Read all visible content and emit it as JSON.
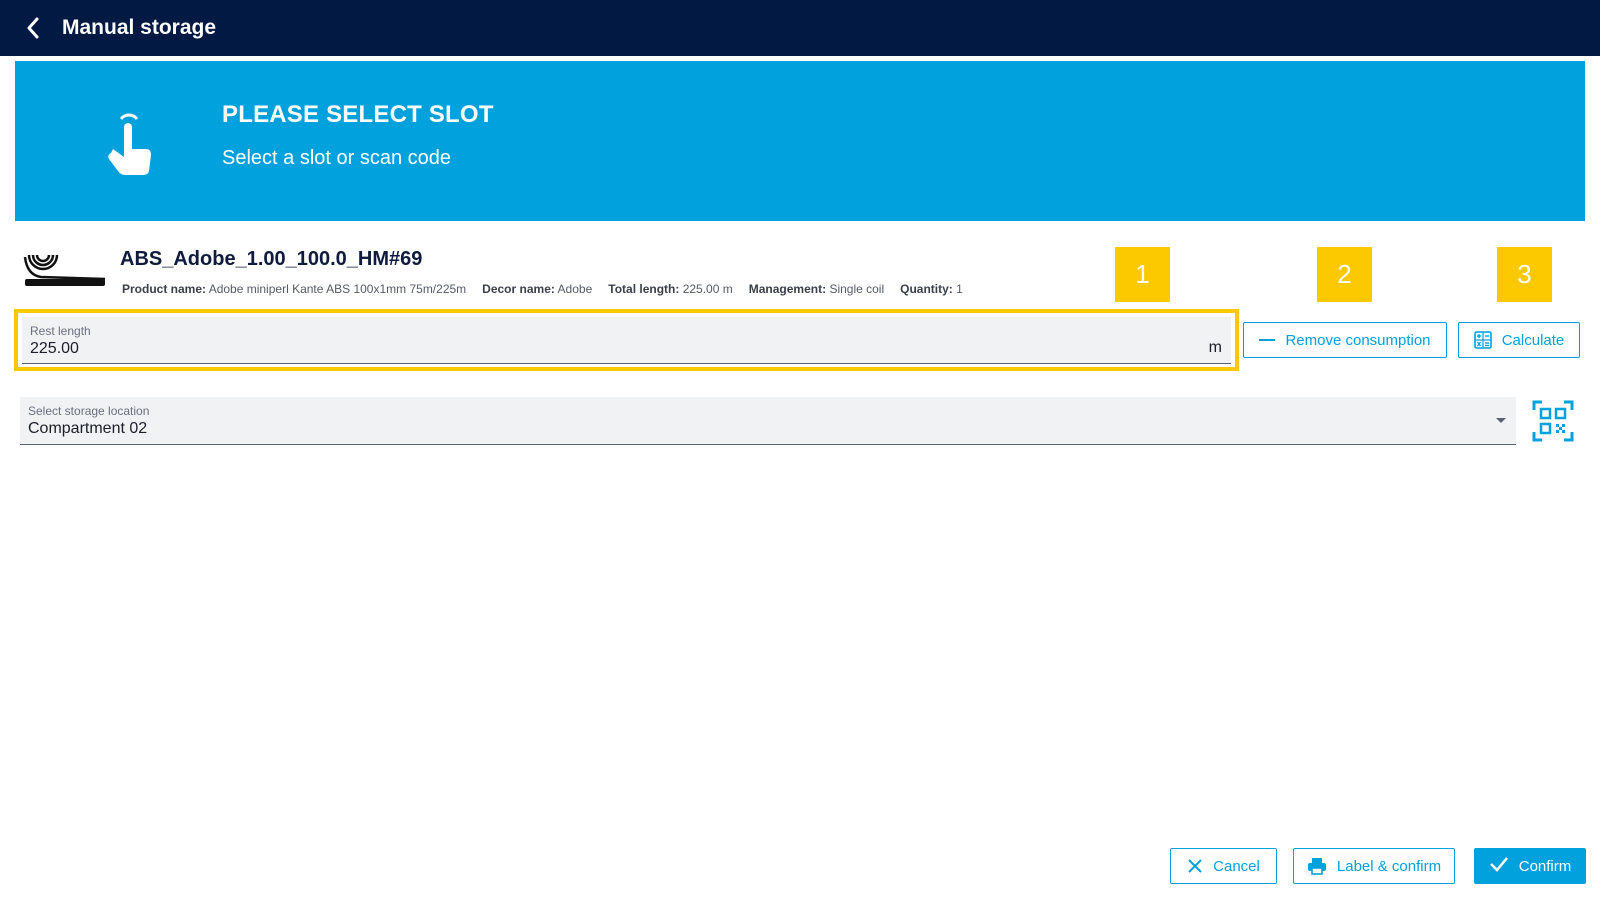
{
  "header": {
    "title": "Manual storage",
    "back_icon": "chevron-left-icon"
  },
  "banner": {
    "title": "PLEASE SELECT SLOT",
    "subtitle": "Select a slot or scan code",
    "icon": "touch-hand-icon",
    "color": "#00a1dd"
  },
  "product": {
    "title": "ABS_Adobe_1.00_100.0_HM#69",
    "icon": "edge-band-coil-icon",
    "meta": {
      "product_name_label": "Product name:",
      "product_name": "Adobe miniperl Kante ABS 100x1mm 75m/225m",
      "decor_name_label": "Decor name:",
      "decor_name": "Adobe",
      "total_length_label": "Total length:",
      "total_length": "225.00 m",
      "management_label": "Management:",
      "management": "Single coil",
      "quantity_label": "Quantity:",
      "quantity": "1"
    }
  },
  "badges": [
    "1",
    "2",
    "3"
  ],
  "badge_color": "#fcc800",
  "rest_length": {
    "label": "Rest length",
    "value": "225.00",
    "unit": "m"
  },
  "actions": {
    "remove_consumption": "Remove consumption",
    "calculate": "Calculate"
  },
  "storage": {
    "label": "Select storage location",
    "value": "Compartment 02",
    "scan_icon": "qr-scan-icon"
  },
  "footer": {
    "cancel": "Cancel",
    "label_confirm": "Label & confirm",
    "confirm": "Confirm"
  },
  "colors": {
    "header_bg": "#011943",
    "accent": "#00a1dd",
    "highlight": "#fcc800"
  }
}
